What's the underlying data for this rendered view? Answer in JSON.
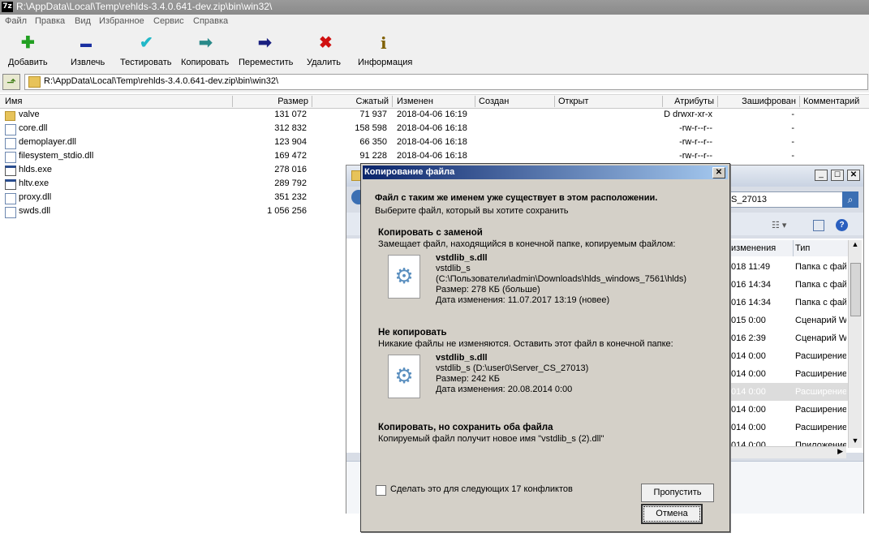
{
  "window": {
    "title": "R:\\AppData\\Local\\Temp\\rehlds-3.4.0.641-dev.zip\\bin\\win32\\",
    "app_icon": "7z"
  },
  "menu": [
    "Файл",
    "Правка",
    "Вид",
    "Избранное",
    "Сервис",
    "Справка"
  ],
  "toolbar": [
    {
      "label": "Добавить",
      "icon": "plus-icon",
      "color": "#22a022",
      "glyph": "✚"
    },
    {
      "label": "Извлечь",
      "icon": "minus-icon",
      "color": "#1a2fa0",
      "glyph": "▬"
    },
    {
      "label": "Тестировать",
      "icon": "check-icon",
      "color": "#22b8c8",
      "glyph": "✔"
    },
    {
      "label": "Копировать",
      "icon": "copy-arrow-icon",
      "color": "#2a8a8a",
      "glyph": "➡"
    },
    {
      "label": "Переместить",
      "icon": "move-arrow-icon",
      "color": "#1a2080",
      "glyph": "➡"
    },
    {
      "label": "Удалить",
      "icon": "delete-x-icon",
      "color": "#d01010",
      "glyph": "✖"
    },
    {
      "label": "Информация",
      "icon": "info-icon",
      "color": "#806000",
      "glyph": "i"
    }
  ],
  "address": "R:\\AppData\\Local\\Temp\\rehlds-3.4.0.641-dev.zip\\bin\\win32\\",
  "columns": [
    "Имя",
    "Размер",
    "Сжатый",
    "Изменен",
    "Создан",
    "Открыт",
    "Атрибуты",
    "Зашифрован",
    "Комментарий"
  ],
  "files": [
    {
      "name": "valve",
      "type": "folder",
      "size": "131 072",
      "packed": "71 937",
      "modified": "2018-04-06 16:19",
      "attr": "D drwxr-xr-x",
      "enc": "-"
    },
    {
      "name": "core.dll",
      "type": "dll",
      "size": "312 832",
      "packed": "158 598",
      "modified": "2018-04-06 16:18",
      "attr": "-rw-r--r--",
      "enc": "-"
    },
    {
      "name": "demoplayer.dll",
      "type": "dll",
      "size": "123 904",
      "packed": "66 350",
      "modified": "2018-04-06 16:18",
      "attr": "-rw-r--r--",
      "enc": "-"
    },
    {
      "name": "filesystem_stdio.dll",
      "type": "dll",
      "size": "169 472",
      "packed": "91 228",
      "modified": "2018-04-06 16:18",
      "attr": "-rw-r--r--",
      "enc": "-"
    },
    {
      "name": "hlds.exe",
      "type": "exe",
      "size": "278 016",
      "packed": "",
      "modified": "",
      "attr": "",
      "enc": ""
    },
    {
      "name": "hltv.exe",
      "type": "exe",
      "size": "289 792",
      "packed": "",
      "modified": "",
      "attr": "",
      "enc": ""
    },
    {
      "name": "proxy.dll",
      "type": "dll",
      "size": "351 232",
      "packed": "",
      "modified": "",
      "attr": "",
      "enc": ""
    },
    {
      "name": "swds.dll",
      "type": "dll",
      "size": "1 056 256",
      "packed": "",
      "modified": "",
      "attr": "",
      "enc": ""
    }
  ],
  "explorer": {
    "search_text": "S_27013",
    "col_changed": "изменения",
    "col_type": "Тип",
    "rows": [
      {
        "date": "018 11:49",
        "type": "Папка с фай"
      },
      {
        "date": "016 14:34",
        "type": "Папка с фай"
      },
      {
        "date": "016 14:34",
        "type": "Папка с фай"
      },
      {
        "date": "015 0:00",
        "type": "Сценарий Wi"
      },
      {
        "date": "016 2:39",
        "type": "Сценарий Wi"
      },
      {
        "date": "014 0:00",
        "type": "Расширение"
      },
      {
        "date": "014 0:00",
        "type": "Расширение"
      },
      {
        "date": "014 0:00",
        "type": "Расширение"
      },
      {
        "date": "014 0:00",
        "type": "Расширение"
      },
      {
        "date": "014 0:00",
        "type": "Расширение"
      },
      {
        "date": "014 0:00",
        "type": "Приложение"
      }
    ]
  },
  "dialog": {
    "title": "Копирование файла",
    "heading": "Файл с таким же именем уже существует в этом расположении.",
    "subheading": "Выберите файл, который вы хотите сохранить",
    "opt1": {
      "title": "Копировать с заменой",
      "desc": "Замещает файл, находящийся в конечной папке, копируемым файлом:",
      "file": "vstdlib_s.dll",
      "l1": "vstdlib_s",
      "l2": "(C:\\Пользователи\\admin\\Downloads\\hlds_windows_7561\\hlds)",
      "l3": "Размер: 278 КБ (больше)",
      "l4": "Дата изменения: 11.07.2017 13:19 (новее)"
    },
    "opt2": {
      "title": "Не копировать",
      "desc": "Никакие файлы не изменяются. Оставить этот файл в конечной папке:",
      "file": "vstdlib_s.dll",
      "l1": "vstdlib_s (D:\\user0\\Server_CS_27013)",
      "l2": "Размер: 242 КБ",
      "l3": "Дата изменения: 20.08.2014 0:00"
    },
    "opt3": {
      "title": "Копировать, но сохранить оба файла",
      "desc": "Копируемый файл получит новое имя \"vstdlib_s (2).dll\""
    },
    "checkbox": "Сделать это для следующих 17 конфликтов",
    "skip": "Пропустить",
    "cancel": "Отмена"
  }
}
